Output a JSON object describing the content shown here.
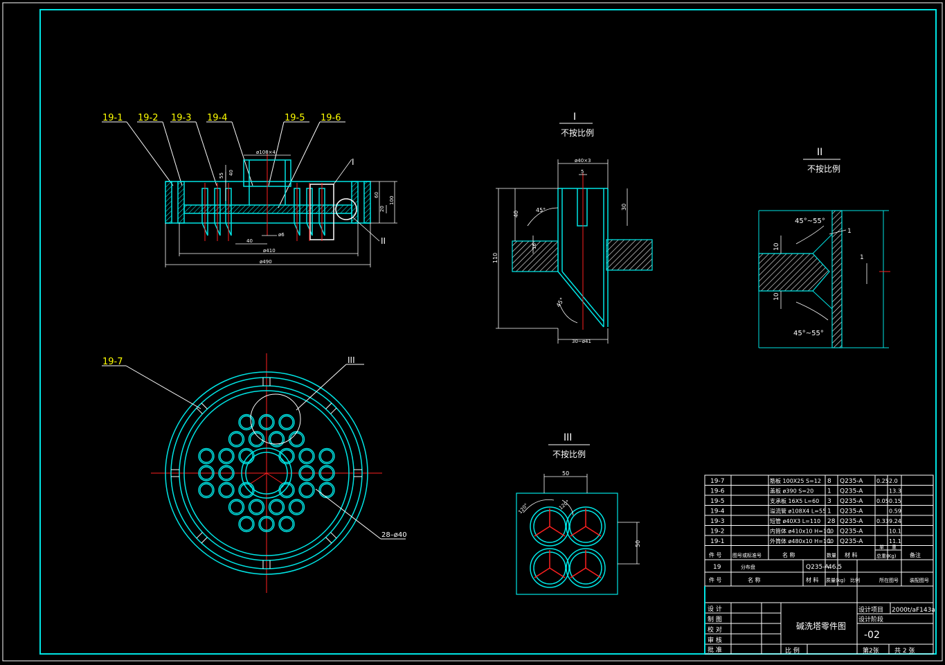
{
  "labels": {
    "parts_top": [
      "19-1",
      "19-2",
      "19-3",
      "19-4",
      "19-5",
      "19-6"
    ],
    "part_bottom": "19-7",
    "ref_I": "I",
    "ref_II": "II",
    "ref_III": "III"
  },
  "dims_section": {
    "d108": "ø108×4",
    "d55": "55",
    "d40v": "40",
    "d60": "60",
    "d20": "20",
    "d100": "100",
    "d40h": "40",
    "d6": "ø6",
    "d410": "ø410",
    "d490": "ø490"
  },
  "plan": {
    "holes": "28–ø40"
  },
  "detail_I": {
    "title": "I",
    "subtitle": "不按比例",
    "d40x3": "ø40×3",
    "d5": "5",
    "d30": "30",
    "d40": "40",
    "d110": "110",
    "a45a": "45°",
    "a45b": "45°",
    "d16": "16",
    "bottom": "30~ø41"
  },
  "detail_II": {
    "title": "II",
    "subtitle": "不按比例",
    "ang_top": "45°~55°",
    "ang_bot": "45°~55°",
    "d10a": "10",
    "d10b": "10",
    "d1a": "1",
    "d1b": "1"
  },
  "detail_III": {
    "title": "III",
    "subtitle": "不按比例",
    "d50h": "50",
    "d50v": "50",
    "a120a": "120°",
    "a120b": "120°"
  },
  "bom": {
    "rows": [
      {
        "no": "19-7",
        "name": "筋板 100X25 S=12",
        "qty": "8",
        "mat": "Q235-A",
        "unit": "0.25",
        "total": "2.0"
      },
      {
        "no": "19-6",
        "name": "盖板 ø390 S=20",
        "qty": "1",
        "mat": "Q235-A",
        "unit": "",
        "total": "13.3"
      },
      {
        "no": "19-5",
        "name": "支承板 16X5 L=60",
        "qty": "3",
        "mat": "Q235-A",
        "unit": "0.05",
        "total": "0.15"
      },
      {
        "no": "19-4",
        "name": "溢流管 ø108X4 L=55",
        "qty": "1",
        "mat": "Q235-A",
        "unit": "",
        "total": "0.59"
      },
      {
        "no": "19-3",
        "name": "短管 ø40X3 L=110",
        "qty": "28",
        "mat": "Q235-A",
        "unit": "0.33",
        "total": "9.24"
      },
      {
        "no": "19-2",
        "name": "内筒体 ø410x10 H=100",
        "qty": "1",
        "mat": "Q235-A",
        "unit": "",
        "total": "10.1"
      },
      {
        "no": "19-1",
        "name": "外筒体 ø480x10 H=100",
        "qty": "1",
        "mat": "Q235-A",
        "unit": "",
        "total": "11.1"
      }
    ],
    "header1": {
      "no": "件 号",
      "code": "图号或标准号",
      "name": "名  称",
      "qty": "数量",
      "mat": "材  料",
      "single": "单",
      "weight": "重",
      "unit_w": "总重(Kg)",
      "note": "备注"
    },
    "assembly": {
      "no": "19",
      "name": "分布盘",
      "mat": "Q235-A",
      "weight": "46.5"
    },
    "header2": {
      "no": "件 号",
      "name": "名  称",
      "mat": "材  料",
      "weight": "质量(kg)",
      "scale": "比例",
      "drawing": "所在图号",
      "assembly_no": "装配图号"
    }
  },
  "title_block": {
    "roles": [
      "设 计",
      "制 图",
      "校 对",
      "审 核",
      "批 准"
    ],
    "drawing_title": "碱洗塔零件图",
    "project_label": "设计项目",
    "project_value": "2000t/aF143a",
    "stage_label": "设计阶段",
    "number": "-02",
    "scale_label": "比 例",
    "sheet": "第2张",
    "total": "共 2 张"
  }
}
